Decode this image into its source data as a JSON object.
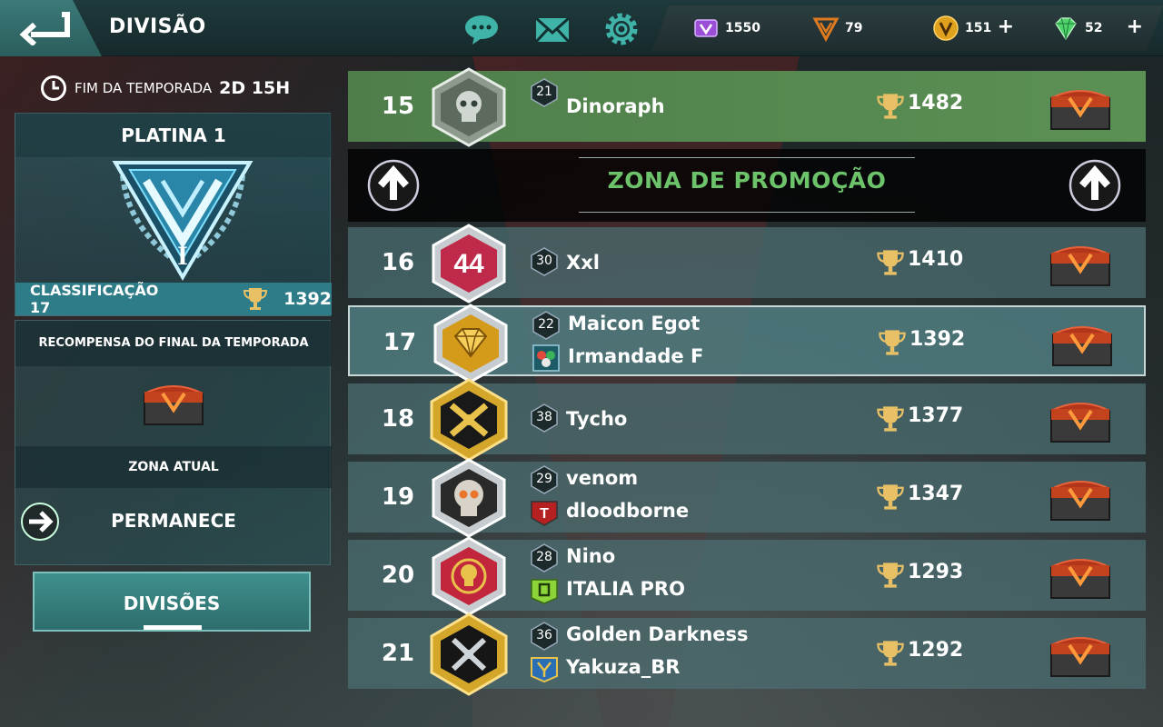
{
  "header": {
    "title": "DIVISÃO",
    "icons": [
      "back-arrow-icon",
      "chat-icon",
      "mail-icon",
      "gear-icon"
    ]
  },
  "currencies": [
    {
      "name": "purple-credits",
      "value": "1550",
      "icon": "purple-token-icon",
      "plus": "",
      "color": "#9b4fd6"
    },
    {
      "name": "orange-tokens",
      "value": "79",
      "icon": "orange-v-token-icon",
      "plus": "",
      "color": "#e07a1f"
    },
    {
      "name": "gold-coins",
      "value": "151",
      "icon": "gold-coin-icon",
      "plus": "+",
      "color": "#e0a11f"
    },
    {
      "name": "gems",
      "value": "52",
      "icon": "green-gem-icon",
      "plus": "+",
      "color": "#4fd36a"
    }
  ],
  "season": {
    "end_label": "FIM DA TEMPORADA",
    "time_left": "2D 15H"
  },
  "rank": {
    "title": "PLATINA 1",
    "tier": "I",
    "classification_label": "CLASSIFICAÇÃO 17",
    "trophies": "1392"
  },
  "reward": {
    "title": "RECOMPENSA DO FINAL DA TEMPORADA",
    "zone_title": "ZONA ATUAL",
    "zone_state": "PERMANECE"
  },
  "divisions_button": "DIVISÕES",
  "promo_zone_label": "ZONA DE PROMOÇÃO",
  "leaderboard": [
    {
      "pos": "15",
      "level": "21",
      "name": "Dinoraph",
      "clan": "",
      "score": "1482",
      "badge": "silver-skull-badge",
      "promo": true
    },
    {
      "pos": "16",
      "level": "30",
      "name": "Xxl",
      "clan": "",
      "score": "1410",
      "badge": "red-44-badge"
    },
    {
      "pos": "17",
      "level": "22",
      "name": "Maicon Egot",
      "clan": "Irmandade F",
      "score": "1392",
      "badge": "gold-diamond-badge",
      "me": true
    },
    {
      "pos": "18",
      "level": "38",
      "name": "Tycho",
      "clan": "",
      "score": "1377",
      "badge": "crossed-swords-badge"
    },
    {
      "pos": "19",
      "level": "29",
      "name": "venom",
      "clan": "dloodborne",
      "score": "1347",
      "badge": "skull-badge"
    },
    {
      "pos": "20",
      "level": "28",
      "name": "Nino",
      "clan": "ITALIA PRO",
      "score": "1293",
      "badge": "red-skull-badge"
    },
    {
      "pos": "21",
      "level": "36",
      "name": "Golden Darkness",
      "clan": "Yakuza_BR",
      "score": "1292",
      "badge": "black-swords-badge"
    }
  ]
}
